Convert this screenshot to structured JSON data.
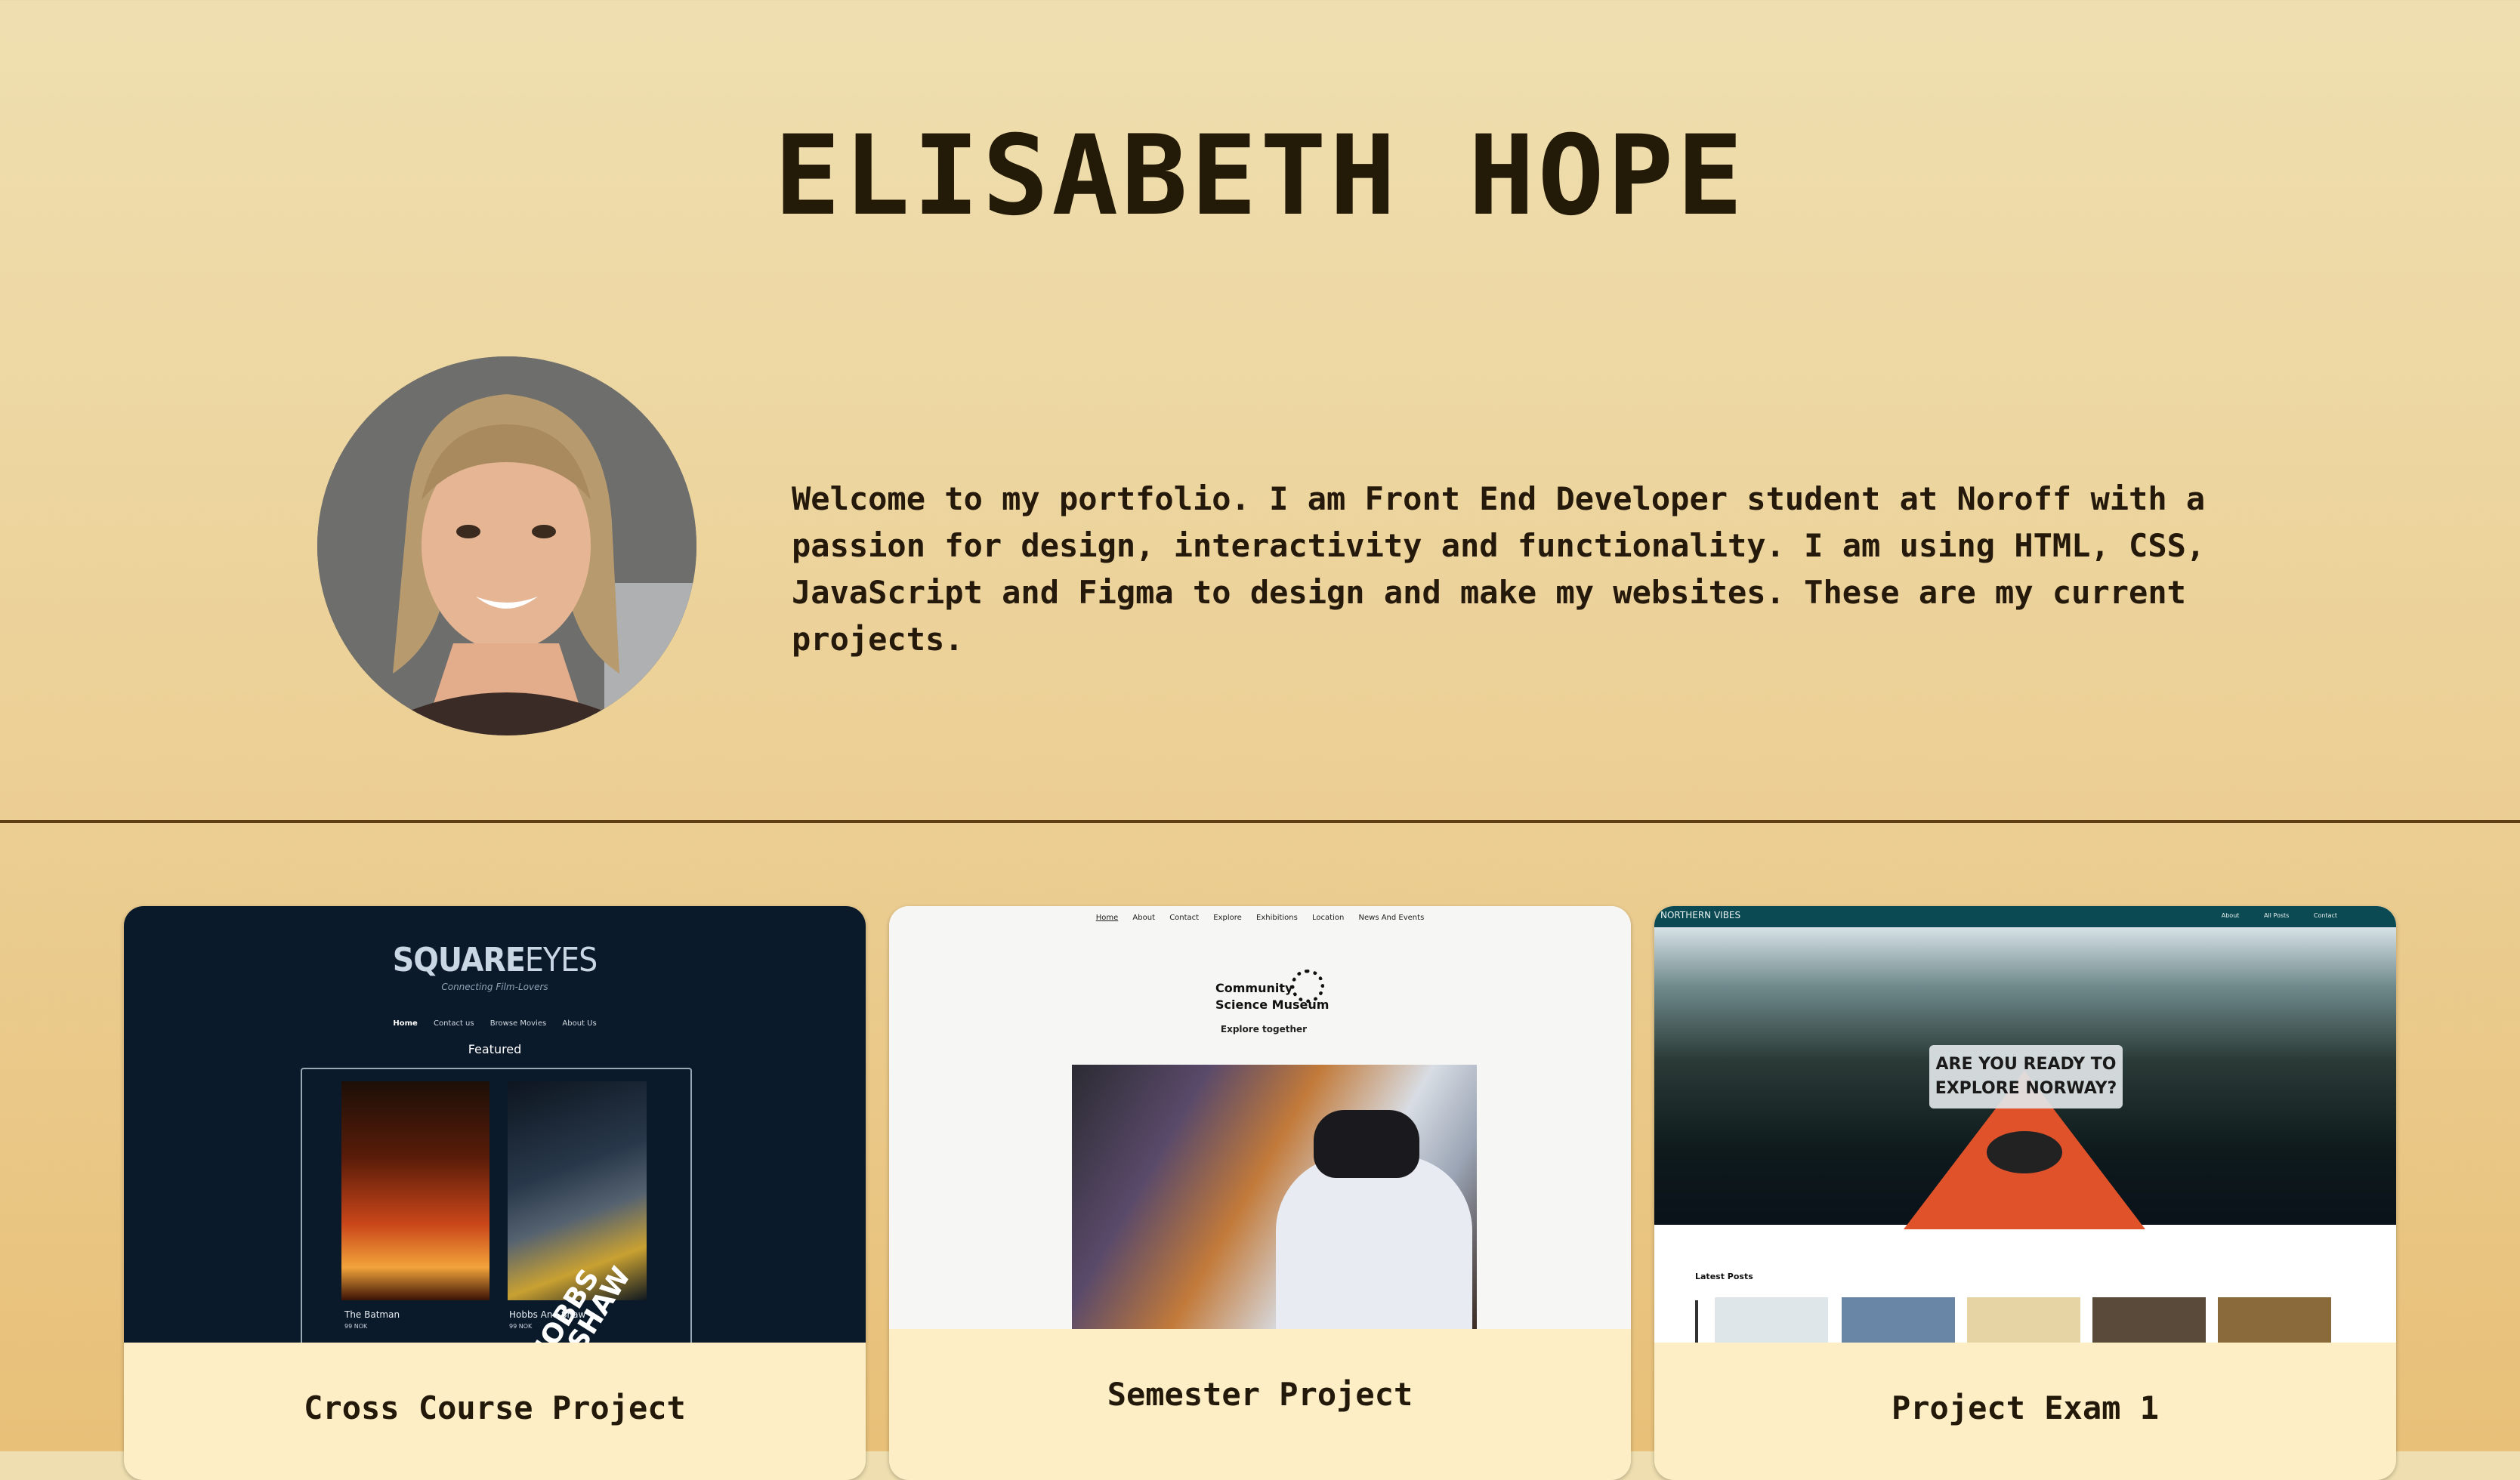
{
  "header": {
    "title": "ELISABETH HOPE"
  },
  "about": {
    "avatar_alt": "Portrait of Elisabeth Hope",
    "intro": "Welcome to my portfolio. I am Front End Developer student at Noroff with a passion for design, interactivity and functionality. I am using HTML, CSS, JavaScript and Figma to design and make my websites. These are my current projects."
  },
  "projects": [
    {
      "title": "Cross Course Project",
      "preview": {
        "logo_left": "SQUARE",
        "logo_right": "EYES",
        "tagline": "Connecting Film-Lovers",
        "nav": [
          "Home",
          "Contact us",
          "Browse Movies",
          "About Us"
        ],
        "section": "Featured",
        "movies": [
          {
            "title": "The Batman",
            "price": "99 NOK"
          },
          {
            "title": "Hobbs And Shaw",
            "price": "99 NOK",
            "poster_text": "HOBBS & SHAW"
          }
        ]
      }
    },
    {
      "title": "Semester Project",
      "preview": {
        "nav": [
          "Home",
          "About",
          "Contact",
          "Explore",
          "Exhibitions",
          "Location",
          "News And Events"
        ],
        "logo_line1": "Community",
        "logo_line2": "Science Museum",
        "subtitle": "Explore together"
      }
    },
    {
      "title": "Project Exam 1",
      "preview": {
        "brand": "NORTHERN VIBES",
        "nav": [
          "About",
          "All Posts",
          "Contact"
        ],
        "hero_line1": "ARE YOU READY TO",
        "hero_line2": "EXPLORE NORWAY?",
        "latest": "Latest Posts"
      }
    }
  ],
  "colors": {
    "background_top": "#efdfb0",
    "background_bottom": "#e8c078",
    "text": "#22190a",
    "card_caption_bg": "#fdeec6",
    "divider": "#5e3f14"
  }
}
